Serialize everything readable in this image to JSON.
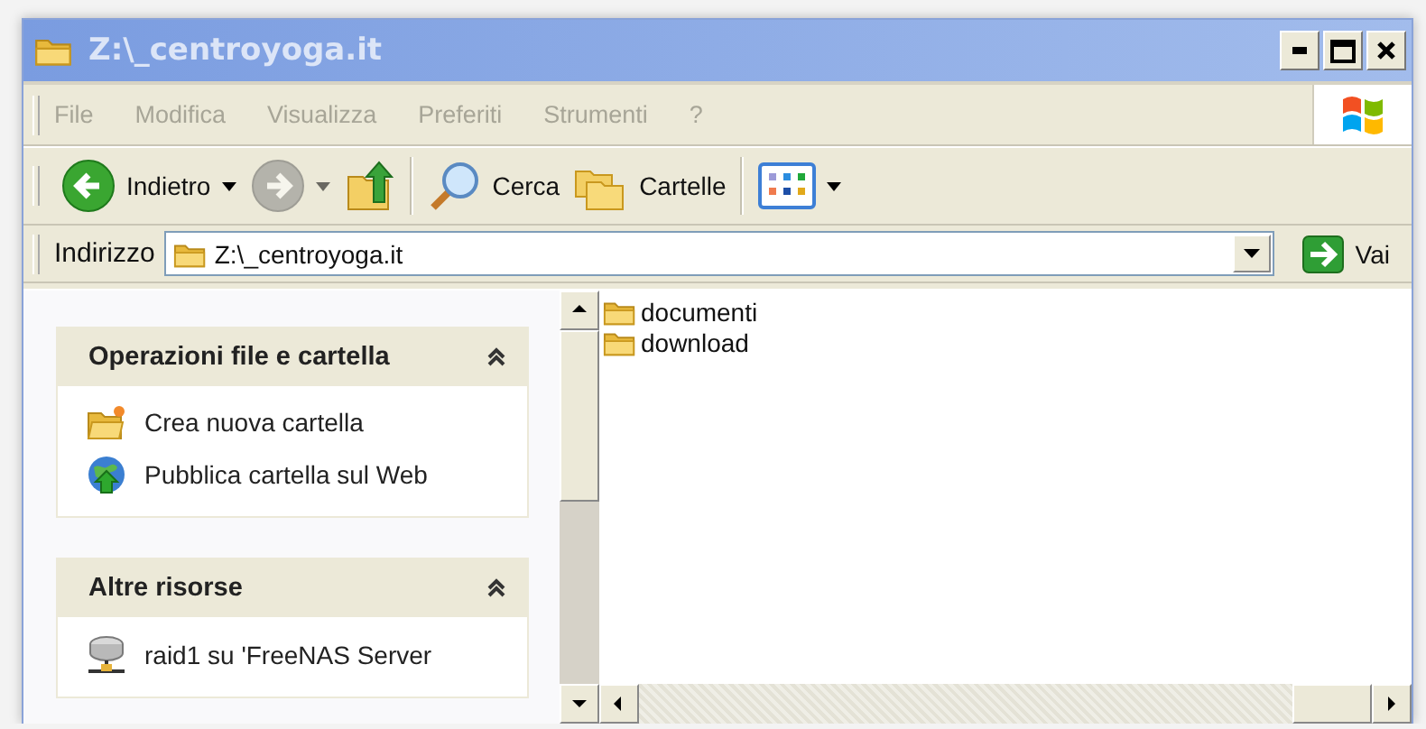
{
  "window": {
    "title": "Z:\\_centroyoga.it",
    "active": false
  },
  "menu": [
    {
      "label": "File"
    },
    {
      "label": "Modifica"
    },
    {
      "label": "Visualizza"
    },
    {
      "label": "Preferiti"
    },
    {
      "label": "Strumenti"
    },
    {
      "label": "?"
    }
  ],
  "toolbar": [
    {
      "kind": "back",
      "label": "Indietro",
      "disabled": false
    },
    {
      "kind": "forward",
      "disabled": true
    },
    {
      "kind": "up",
      "disabled": false
    },
    {
      "kind": "search",
      "label": "Cerca",
      "disabled": false
    },
    {
      "kind": "folders",
      "label": "Cartelle",
      "disabled": false
    },
    {
      "kind": "views",
      "disabled": false
    }
  ],
  "address": {
    "label": "Indirizzo",
    "value": "Z:\\_centroyoga.it",
    "go": "Vai"
  },
  "task_panels": [
    {
      "title": "Operazioni file e cartella",
      "expanded": true,
      "items": [
        {
          "kind": "new-folder",
          "label": "Crea nuova cartella"
        },
        {
          "kind": "publish",
          "label": "Pubblica cartella sul Web"
        }
      ]
    },
    {
      "title": "Altre risorse",
      "expanded": true,
      "items": [
        {
          "kind": "network-drive",
          "label": "raid1 su 'FreeNAS Server"
        }
      ]
    }
  ],
  "files": [
    {
      "name": "documenti"
    },
    {
      "name": "download"
    }
  ]
}
